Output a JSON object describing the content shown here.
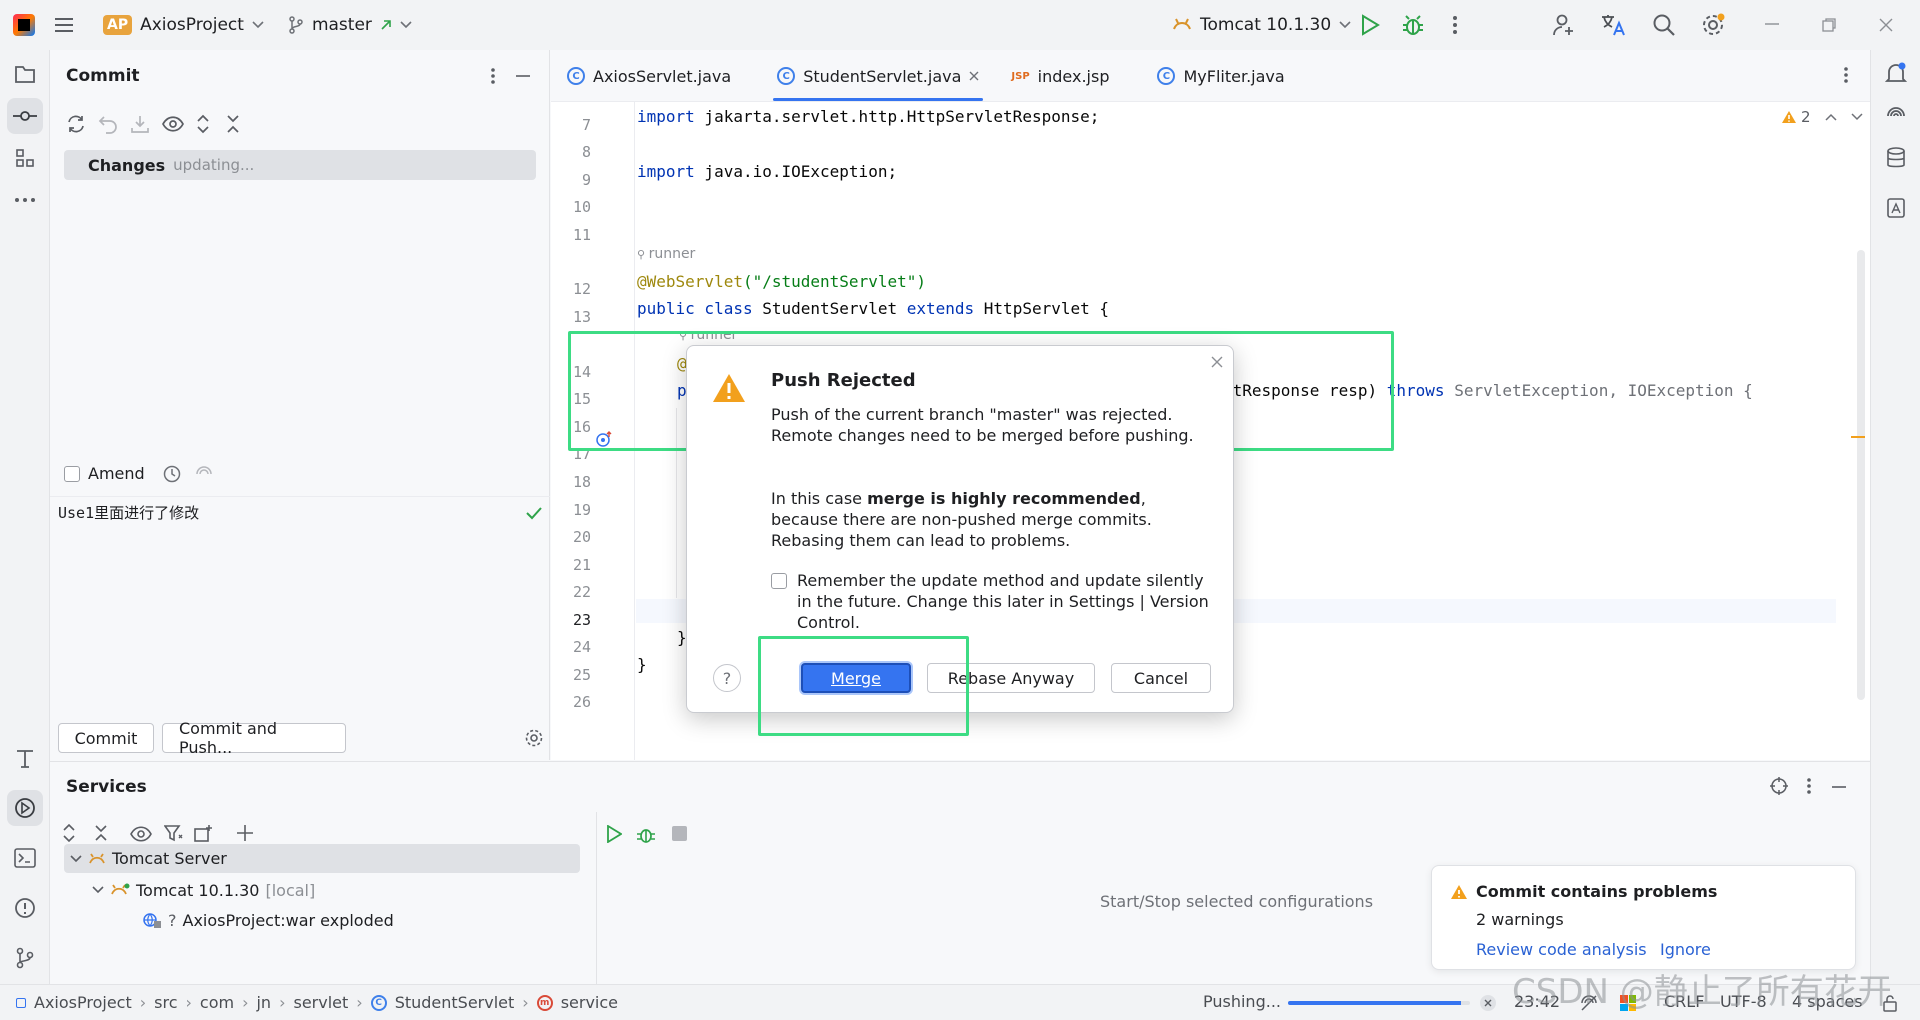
{
  "titlebar": {
    "project_badge": "AP",
    "project_name": "AxiosProject",
    "branch": "master",
    "run_config": "Tomcat 10.1.30"
  },
  "commit_panel": {
    "title": "Commit",
    "changes_label": "Changes",
    "changes_status": "updating...",
    "amend_label": "Amend",
    "message": "Use1里面进行了修改",
    "commit_button": "Commit",
    "commit_push_button": "Commit and Push..."
  },
  "tabs": [
    {
      "label": "AxiosServlet.java"
    },
    {
      "label": "StudentServlet.java"
    },
    {
      "label": "index.jsp"
    },
    {
      "label": "MyFliter.java"
    }
  ],
  "editor": {
    "warnings": "2",
    "line_numbers": [
      "7",
      "8",
      "9",
      "10",
      "11",
      "12",
      "13",
      "14",
      "15",
      "16",
      "17",
      "18",
      "19",
      "20",
      "21",
      "22",
      "23",
      "24",
      "25",
      "26"
    ],
    "line7_kw": "import",
    "line7_rest": " jakarta.servlet.http.HttpServletResponse;",
    "line9_kw": "import",
    "line9_rest": " java.io.IOException;",
    "author_hint": "runner",
    "line12_annot": "@WebServlet",
    "line12_str": "(\"/studentServlet\")",
    "line13_kw1": "public class",
    "line13_mid": " StudentServlet ",
    "line13_kw2": "extends",
    "line13_rest": " HttpServlet {",
    "line14_partial": "@",
    "line15_partial": "p",
    "line15_tail_plain": "etResponse resp) ",
    "line15_tail_kw": "throws",
    "line15_tail_exc": " ServletException, IOException {",
    "line24": "}",
    "line25": "}"
  },
  "dialog": {
    "title": "Push Rejected",
    "msg1": "Push of the current branch \"master\" was rejected. Remote changes need to be merged before pushing.",
    "msg2_pre": "In this case ",
    "msg2_bold": "merge is highly recommended",
    "msg2_post": ", because there are non-pushed merge commits. Rebasing them can lead to problems.",
    "remember": "Remember the update method and update silently in the future. Change this later in Settings | Version Control.",
    "merge_button": "Merge",
    "rebase_button": "Rebase Anyway",
    "cancel_button": "Cancel",
    "help": "?"
  },
  "services": {
    "title": "Services",
    "tree": [
      {
        "label": "Tomcat Server"
      },
      {
        "label": "Tomcat 10.1.30",
        "suffix": "[local]"
      },
      {
        "label": "AxiosProject:war exploded",
        "prefix": "?"
      }
    ],
    "placeholder": "Start/Stop selected configurations"
  },
  "notification": {
    "title": "Commit contains problems",
    "body": "2 warnings",
    "action1": "Review code analysis",
    "action2": "Ignore"
  },
  "statusbar": {
    "breadcrumbs": [
      "AxiosProject",
      "src",
      "com",
      "jn",
      "servlet",
      "StudentServlet",
      "service"
    ],
    "pushing": "Pushing...",
    "progress": 0.95,
    "position": "23:42",
    "line_sep": "CRLF",
    "encoding": "UTF-8",
    "indent": "4 spaces"
  },
  "watermark": "CSDN @静止了所有花开",
  "colors": {
    "accent": "#3574f0",
    "highlight": "#3ddc84",
    "warning": "#f2a01d"
  }
}
